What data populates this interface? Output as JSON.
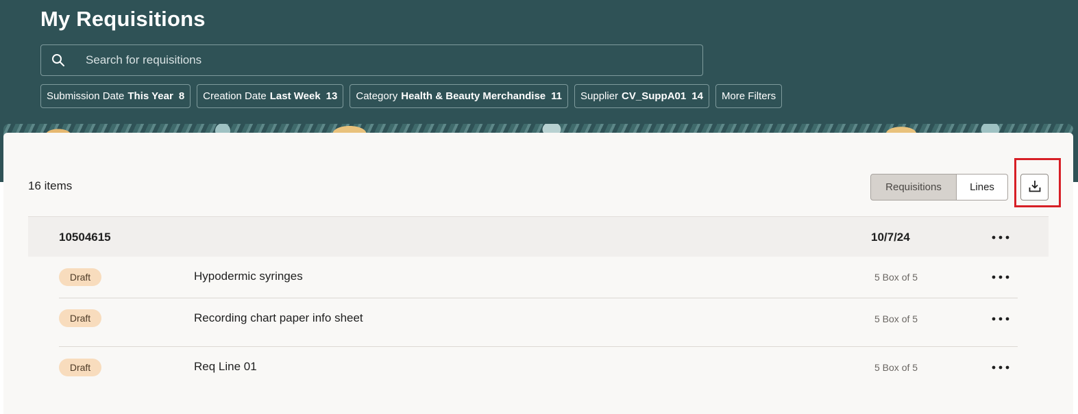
{
  "header": {
    "title": "My Requisitions",
    "search": {
      "placeholder": "Search for requisitions",
      "value": ""
    },
    "filters": [
      {
        "label": "Submission Date",
        "value": "This Year",
        "count": "8"
      },
      {
        "label": "Creation Date",
        "value": "Last Week",
        "count": "13"
      },
      {
        "label": "Category",
        "value": "Health & Beauty Merchandise",
        "count": "11"
      },
      {
        "label": "Supplier",
        "value": "CV_SuppA01",
        "count": "14"
      }
    ],
    "more_filters_label": "More Filters"
  },
  "list": {
    "items_count": "16 items",
    "view_toggle": {
      "requisitions_label": "Requisitions",
      "lines_label": "Lines",
      "selected": "Requisitions"
    },
    "download_icon": "download-icon",
    "requisition": {
      "number": "10504615",
      "date": "10/7/24",
      "lines": [
        {
          "status": "Draft",
          "description": "Hypodermic syringes",
          "quantity": "5 Box of 5"
        },
        {
          "status": "Draft",
          "description": "Recording chart paper info sheet",
          "quantity": "5 Box of 5"
        },
        {
          "status": "Draft",
          "description": "Req Line 01",
          "quantity": "5 Box of 5"
        }
      ]
    }
  },
  "colors": {
    "header_bg": "#2f5256",
    "card_bg": "#f9f8f6",
    "draft_badge_bg": "#f8dcbd",
    "highlight_border": "#d71f26"
  }
}
